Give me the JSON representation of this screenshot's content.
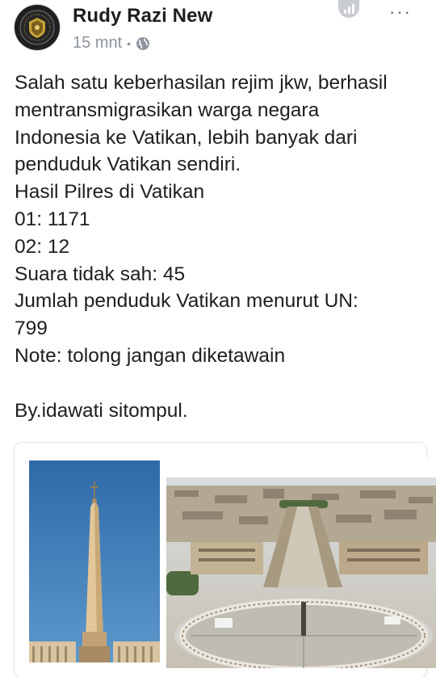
{
  "post": {
    "author": "Rudy Razi New",
    "time": "15 mnt",
    "separator": "•",
    "more_label": "···",
    "lines": [
      "Salah satu keberhasilan rejim jkw, berhasil",
      "mentransmigrasikan warga negara",
      "Indonesia ke Vatikan, lebih banyak dari",
      "penduduk Vatikan sendiri.",
      "Hasil Pilres di Vatikan",
      "01: 1171",
      "02: 12",
      "Suara tidak sah: 45",
      "Jumlah penduduk Vatikan menurut UN:",
      "799",
      "Note: tolong jangan diketawain"
    ],
    "signature": "By.idawati sitompul."
  },
  "icons": {
    "avatar": "emblem-avatar",
    "privacy": "globe-icon",
    "stats": "insights-icon",
    "more": "more-options-icon"
  },
  "colors": {
    "text": "#1c1e21",
    "meta": "#8d949e",
    "icon": "#c9ccd1",
    "sky": "#3b7ab8"
  }
}
